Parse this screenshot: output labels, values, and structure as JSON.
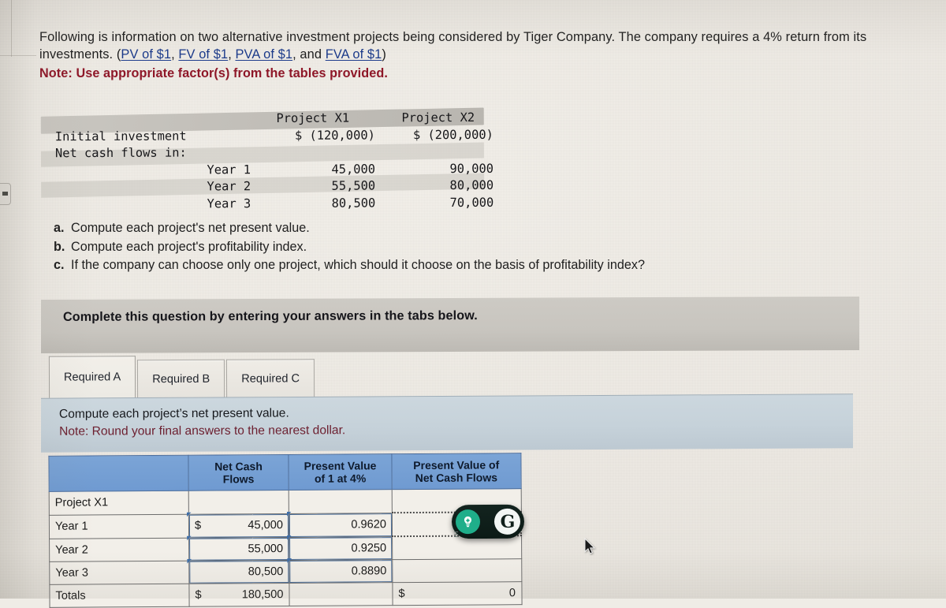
{
  "intro": {
    "line1_a": "Following is information on two alternative investment projects being considered by Tiger Company. The company requires a 4%",
    "line2_a": "return from its investments. (",
    "link_pv": "PV of $1",
    "sep1": ", ",
    "link_fv": "FV of $1",
    "sep2": ", ",
    "link_pva": "PVA of $1",
    "sep3": ", and ",
    "link_fva": "FVA of $1",
    "sep4": ")",
    "note": "Note: Use appropriate factor(s) from the tables provided."
  },
  "problem_table": {
    "col_headers": [
      "",
      "Project X1",
      "Project X2"
    ],
    "rows": [
      {
        "label": "Initial investment",
        "x1": "$ (120,000)",
        "x2": "$ (200,000)"
      },
      {
        "label": "Net cash flows in:",
        "x1": "",
        "x2": ""
      },
      {
        "label": "Year 1",
        "x1": "45,000",
        "x2": "90,000"
      },
      {
        "label": "Year 2",
        "x1": "55,500",
        "x2": "80,000"
      },
      {
        "label": "Year 3",
        "x1": "80,500",
        "x2": "70,000"
      }
    ]
  },
  "questions": [
    {
      "marker": "a.",
      "text": "Compute each project's net present value."
    },
    {
      "marker": "b.",
      "text": "Compute each project's profitability index."
    },
    {
      "marker": "c.",
      "text": "If the company can choose only one project, which should it choose on the basis of profitability index?"
    }
  ],
  "complete_bar": {
    "text": "Complete this question by entering your answers in the tabs below."
  },
  "tabs": [
    {
      "label": "Required A",
      "active": true
    },
    {
      "label": "Required B",
      "active": false
    },
    {
      "label": "Required C",
      "active": false
    }
  ],
  "instruction": {
    "line1": "Compute each project’s net present value.",
    "line2": "Note: Round your final answers to the nearest dollar."
  },
  "answer_grid": {
    "headers": [
      "",
      "Net Cash Flows",
      "Present Value of 1 at 4%",
      "Present Value of Net Cash Flows"
    ],
    "headers_wrapped": [
      {
        "l1": "",
        "l2": ""
      },
      {
        "l1": "Net Cash",
        "l2": "Flows"
      },
      {
        "l1": "Present Value",
        "l2": "of 1 at 4%"
      },
      {
        "l1": "Present Value of",
        "l2": "Net Cash Flows"
      }
    ],
    "rows": [
      {
        "label": "Project X1",
        "dollar": "",
        "ncf": "",
        "pv": "",
        "pvncf_dollar": "",
        "pvncf": ""
      },
      {
        "label": "Year 1",
        "dollar": "$",
        "ncf": "45,000",
        "pv": "0.9620",
        "pvncf_dollar": "",
        "pvncf": ""
      },
      {
        "label": "Year 2",
        "dollar": "",
        "ncf": "55,000",
        "pv": "0.9250",
        "pvncf_dollar": "",
        "pvncf": ""
      },
      {
        "label": "Year 3",
        "dollar": "",
        "ncf": "80,500",
        "pv": "0.8890",
        "pvncf_dollar": "",
        "pvncf": ""
      },
      {
        "label": "Totals",
        "dollar": "$",
        "ncf": "180,500",
        "pv": "",
        "pvncf_dollar": "$",
        "pvncf": "0"
      }
    ]
  },
  "widget": {
    "bulb_icon": "lightbulb-icon",
    "brand_letter": "G"
  },
  "colors": {
    "header_blue": "#6f9ad1",
    "note_red": "#8e1728",
    "link_blue": "#1b3a8a",
    "grey_bar": "#c8c5bf",
    "blue_band": "#c6d2da",
    "widget_green": "#1fae8a"
  }
}
